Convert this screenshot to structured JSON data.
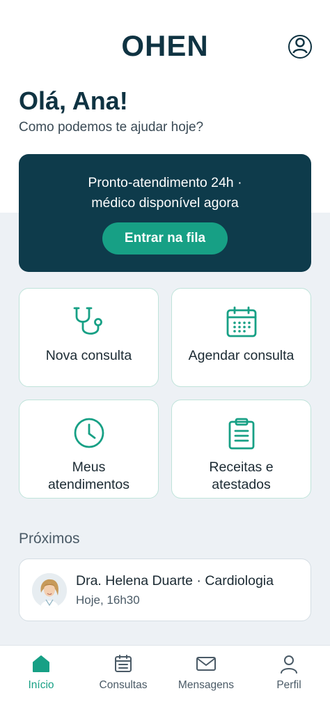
{
  "header": {
    "logo": "OHEN",
    "profile_icon": "user-circle-icon"
  },
  "greeting": {
    "title": "Olá, Ana!",
    "subtitle": "Como podemos te ajudar hoje?"
  },
  "banner": {
    "line1": "Pronto-atendimento 24h ·",
    "line2": "médico disponível agora",
    "button_label": "Entrar na fila"
  },
  "tiles": [
    {
      "label": "Nova consulta",
      "icon": "stethoscope-icon"
    },
    {
      "label": "Agendar consulta",
      "icon": "calendar-icon"
    },
    {
      "label_line1": "Meus",
      "label_line2": "atendimentos",
      "icon": "clock-icon"
    },
    {
      "label_line1": "Receitas e",
      "label_line2": "atestados",
      "icon": "clipboard-icon"
    }
  ],
  "upcoming": {
    "title": "Próximos",
    "items": [
      {
        "doctor": "Dra. Helena Duarte · Cardiologia",
        "time": "Hoje, 16h30",
        "avatar": "doctor-avatar"
      }
    ]
  },
  "tabbar": {
    "active": "Início",
    "items": [
      {
        "label": "Início",
        "icon": "home-icon"
      },
      {
        "label": "Consultas",
        "icon": "list-icon"
      },
      {
        "label": "Mensagens",
        "icon": "mail-icon"
      },
      {
        "label": "Perfil",
        "icon": "person-icon"
      }
    ]
  },
  "colors": {
    "primary_dark": "#0e3b4b",
    "accent": "#17a085",
    "background": "#edf1f5"
  }
}
